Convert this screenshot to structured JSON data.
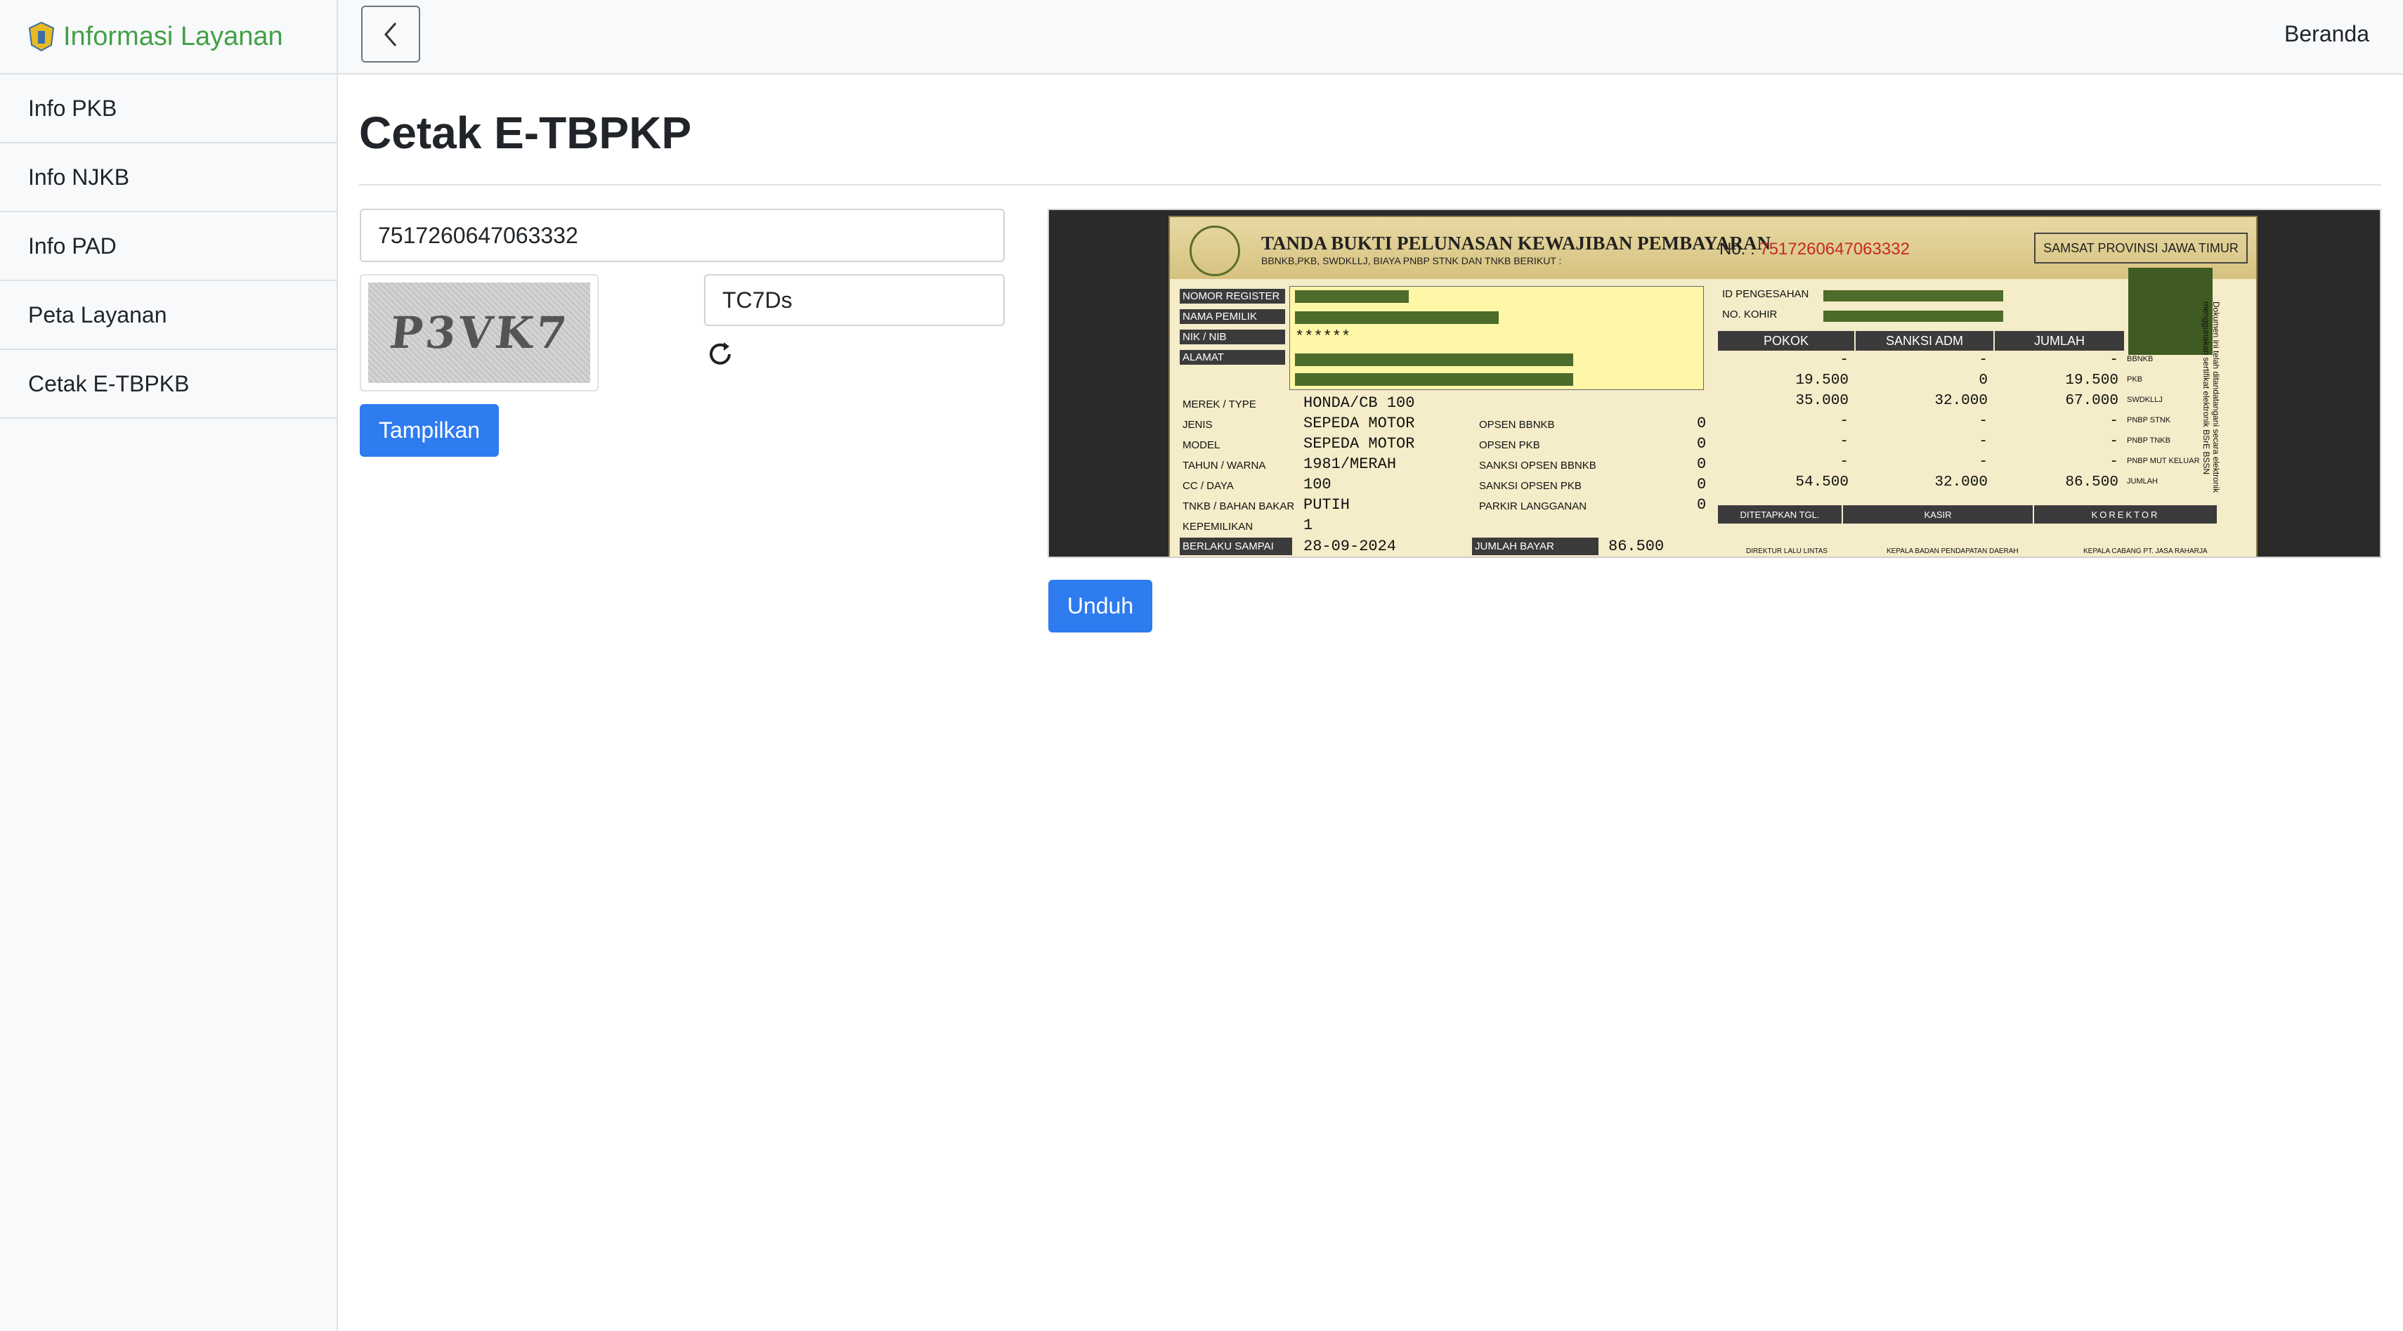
{
  "sidebar": {
    "brand_title": "Informasi Layanan",
    "items": [
      {
        "label": "Info PKB"
      },
      {
        "label": "Info NJKB"
      },
      {
        "label": "Info PAD"
      },
      {
        "label": "Peta Layanan"
      },
      {
        "label": "Cetak E-TBPKB"
      }
    ]
  },
  "topbar": {
    "back_icon": "chevron-left-icon",
    "home_link": "Beranda"
  },
  "main": {
    "page_title": "Cetak E-TBPKP",
    "nomor_input_value": "7517260647063332",
    "captcha_text": "P3VK7",
    "captcha_input_value": "TC7Ds",
    "refresh_icon": "refresh-icon",
    "tampilkan_label": "Tampilkan",
    "unduh_label": "Unduh"
  },
  "receipt": {
    "title": "TANDA BUKTI PELUNASAN KEWAJIBAN PEMBAYARAN",
    "subtitle": "BBNKB,PKB, SWDKLLJ, BIAYA PNBP STNK DAN TNKB BERIKUT :",
    "no_label": "No. :",
    "no_value": "7517260647063332",
    "samsat": "SAMSAT PROVINSI JAWA TIMUR",
    "labels": {
      "nomor_register": "NOMOR REGISTER",
      "nama_pemilik": "NAMA PEMILIK",
      "nik": "NIK / NIB",
      "alamat": "ALAMAT",
      "merek": "MEREK / TYPE",
      "jenis": "JENIS",
      "model": "MODEL",
      "tahun": "TAHUN / WARNA",
      "cc": "CC / DAYA",
      "tnkb": "TNKB / BAHAN BAKAR",
      "kepemilikan": "KEPEMILIKAN",
      "berlaku": "BERLAKU SAMPAI",
      "jumlah_bayar": "JUMLAH BAYAR",
      "id_pengesahan": "ID PENGESAHAN",
      "no_kohir": "NO. KOHIR",
      "opsen_bbnkb": "OPSEN BBNKB",
      "opsen_pkb": "OPSEN PKB",
      "sanksi_opsen_bbnkb": "SANKSI OPSEN BBNKB",
      "sanksi_opsen_pkb": "SANKSI OPSEN PKB",
      "parkir": "PARKIR LANGGANAN",
      "ditetapkan": "DITETAPKAN TGL.",
      "kasir": "KASIR",
      "korektor": "KOREKTOR"
    },
    "nik_value": "******",
    "merek_value": "HONDA/CB 100",
    "jenis_value": "SEPEDA MOTOR",
    "model_value": "SEPEDA MOTOR",
    "tahun_value": "1981/MERAH",
    "cc_value": "100",
    "tnkb_value": "PUTIH",
    "kepemilikan_value": "1",
    "berlaku_value": "28-09-2024",
    "jumlah_bayar_value": "86.500",
    "opsen_values": [
      "0",
      "0",
      "0",
      "0",
      "0"
    ],
    "table_headers": [
      "POKOK",
      "SANKSI ADM",
      "JUMLAH"
    ],
    "row_labels": [
      "BBNKB",
      "PKB",
      "SWDKLLJ",
      "PNBP STNK",
      "PNBP TNKB",
      "PNBP MUT KELUAR",
      "JUMLAH"
    ],
    "rows": [
      [
        "-",
        "-",
        "-"
      ],
      [
        "19.500",
        "0",
        "19.500"
      ],
      [
        "35.000",
        "32.000",
        "67.000"
      ],
      [
        "-",
        "-",
        "-"
      ],
      [
        "-",
        "-",
        "-"
      ],
      [
        "-",
        "-",
        "-"
      ],
      [
        "54.500",
        "32.000",
        "86.500"
      ]
    ],
    "side_note": "Dokumen ini telah ditandatangani secara elektronik menggunakan sertifikat elektronik BSrE BSSN",
    "footer": [
      "DIREKTUR LALU LINTAS",
      "KEPALA BADAN PENDAPATAN DAERAH",
      "KEPALA CABANG PT. JASA RAHARJA"
    ]
  }
}
